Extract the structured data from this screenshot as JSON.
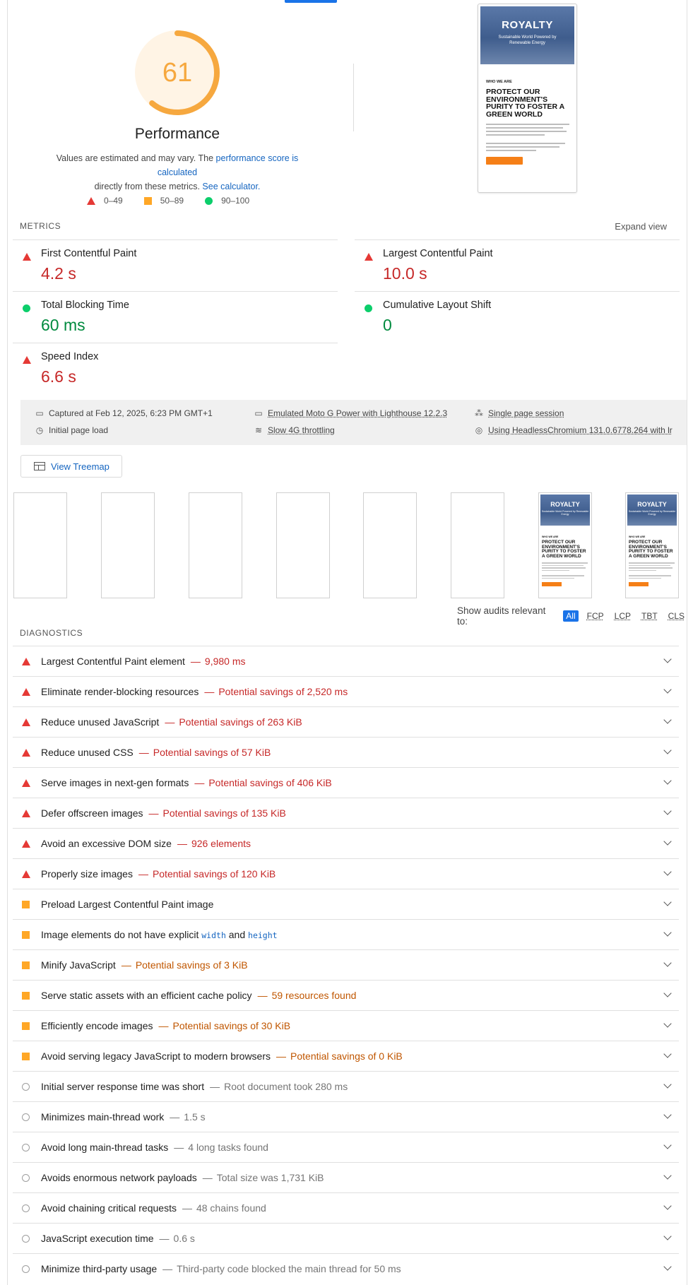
{
  "score": {
    "value": "61",
    "fraction": 0.61,
    "color": "#f6a83f",
    "title": "Performance",
    "desc_prefix": "Values are estimated and may vary. The ",
    "desc_link1": "performance score is calculated",
    "desc_mid": "directly from these metrics. ",
    "desc_link2": "See calculator.",
    "legend": [
      {
        "icon": "red-triangle-icon",
        "label": "0–49"
      },
      {
        "icon": "orange-square-icon",
        "label": "50–89"
      },
      {
        "icon": "green-circle-icon",
        "label": "90–100"
      }
    ]
  },
  "preview": {
    "logo": "ROYALTY",
    "tagline": "Sustainable World Powered by Renewable Energy",
    "who": "WHO WE ARE",
    "headline": "PROTECT OUR ENVIRONMENT'S PURITY TO FOSTER A GREEN WORLD"
  },
  "metrics": {
    "label": "METRICS",
    "expand": "Expand view",
    "items": [
      {
        "name": "First Contentful Paint",
        "value": "4.2 s",
        "status": "red"
      },
      {
        "name": "Largest Contentful Paint",
        "value": "10.0 s",
        "status": "red"
      },
      {
        "name": "Total Blocking Time",
        "value": "60 ms",
        "status": "green"
      },
      {
        "name": "Cumulative Layout Shift",
        "value": "0",
        "status": "green"
      },
      {
        "name": "Speed Index",
        "value": "6.6 s",
        "status": "red"
      }
    ]
  },
  "env": {
    "captured": "Captured at Feb 12, 2025, 6:23 PM GMT+1",
    "load": "Initial page load",
    "device": "Emulated Moto G Power with Lighthouse 12.2.3",
    "throttling": "Slow 4G throttling",
    "session": "Single page session",
    "browser": "Using HeadlessChromium 131.0.6778.264 with lr"
  },
  "treemap_label": "View Treemap",
  "filter": {
    "label": "Show audits relevant to:",
    "chips": [
      "All",
      "FCP",
      "LCP",
      "TBT",
      "CLS"
    ]
  },
  "diagnostics": {
    "label": "DIAGNOSTICS",
    "items": [
      {
        "status": "fail",
        "title": "Largest Contentful Paint element",
        "display": "9,980 ms"
      },
      {
        "status": "fail",
        "title": "Eliminate render-blocking resources",
        "display": "Potential savings of 2,520 ms"
      },
      {
        "status": "fail",
        "title": "Reduce unused JavaScript",
        "display": "Potential savings of 263 KiB"
      },
      {
        "status": "fail",
        "title": "Reduce unused CSS",
        "display": "Potential savings of 57 KiB"
      },
      {
        "status": "fail",
        "title": "Serve images in next-gen formats",
        "display": "Potential savings of 406 KiB"
      },
      {
        "status": "fail",
        "title": "Defer offscreen images",
        "display": "Potential savings of 135 KiB"
      },
      {
        "status": "fail",
        "title": "Avoid an excessive DOM size",
        "display": "926 elements"
      },
      {
        "status": "fail",
        "title": "Properly size images",
        "display": "Potential savings of 120 KiB"
      },
      {
        "status": "average",
        "title": "Preload Largest Contentful Paint image",
        "display": ""
      },
      {
        "status": "average",
        "title": "Image elements do not have explicit",
        "code1": "width",
        "and": "and",
        "code2": "height",
        "display": ""
      },
      {
        "status": "average",
        "title": "Minify JavaScript",
        "display": "Potential savings of 3 KiB"
      },
      {
        "status": "average",
        "title": "Serve static assets with an efficient cache policy",
        "display": "59 resources found"
      },
      {
        "status": "average",
        "title": "Efficiently encode images",
        "display": "Potential savings of 30 KiB"
      },
      {
        "status": "average",
        "title": "Avoid serving legacy JavaScript to modern browsers",
        "display": "Potential savings of 0 KiB"
      },
      {
        "status": "info",
        "title": "Initial server response time was short",
        "display": "Root document took 280 ms"
      },
      {
        "status": "info",
        "title": "Minimizes main-thread work",
        "display": "1.5 s"
      },
      {
        "status": "info",
        "title": "Avoid long main-thread tasks",
        "display": "4 long tasks found"
      },
      {
        "status": "info",
        "title": "Avoids enormous network payloads",
        "display": "Total size was 1,731 KiB"
      },
      {
        "status": "info",
        "title": "Avoid chaining critical requests",
        "display": "48 chains found"
      },
      {
        "status": "info",
        "title": "JavaScript execution time",
        "display": "0.6 s"
      },
      {
        "status": "info",
        "title": "Minimize third-party usage",
        "display": "Third-party code blocked the main thread for 50 ms"
      }
    ]
  }
}
